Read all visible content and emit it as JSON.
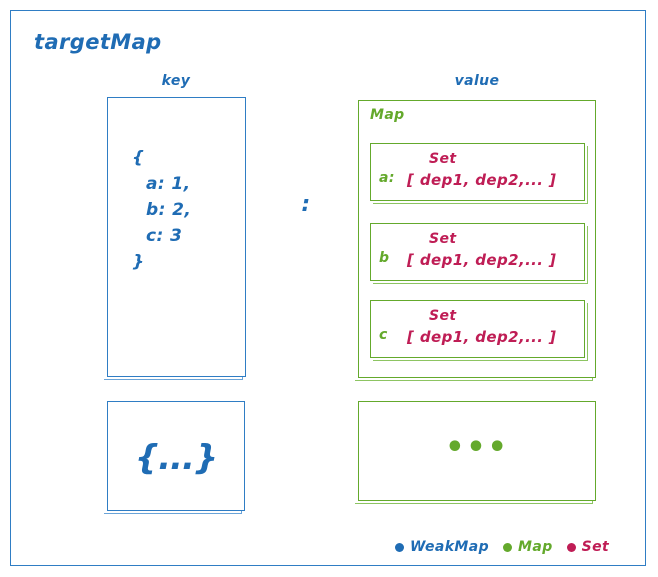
{
  "diagram": {
    "title": "targetMap",
    "colors": {
      "weakmap_blue": "#1f6cb4",
      "map_green": "#64a92c",
      "set_crimson": "#bf1d55",
      "frame_blue": "#2f7dc4",
      "background": "#ffffff"
    },
    "columns": {
      "key_label": "key",
      "value_label": "value"
    },
    "separator": ":"
  },
  "key_column": {
    "object_lines": [
      "{",
      "a: 1,",
      "b: 2,",
      "c: 3",
      "}"
    ],
    "more_glyph": "{...}"
  },
  "value_column": {
    "map_label": "Map",
    "sets": [
      {
        "key": "a:",
        "type_label": "Set",
        "items": "[ dep1, dep2,... ]"
      },
      {
        "key": "b",
        "type_label": "Set",
        "items": "[ dep1, dep2,... ]"
      },
      {
        "key": "c",
        "type_label": "Set",
        "items": "[ dep1, dep2,... ]"
      }
    ],
    "more_glyph": "•••"
  },
  "legend": {
    "items": [
      {
        "label": "WeakMap",
        "color": "#1f6cb4"
      },
      {
        "label": "Map",
        "color": "#64a92c"
      },
      {
        "label": "Set",
        "color": "#bf1d55"
      }
    ]
  }
}
